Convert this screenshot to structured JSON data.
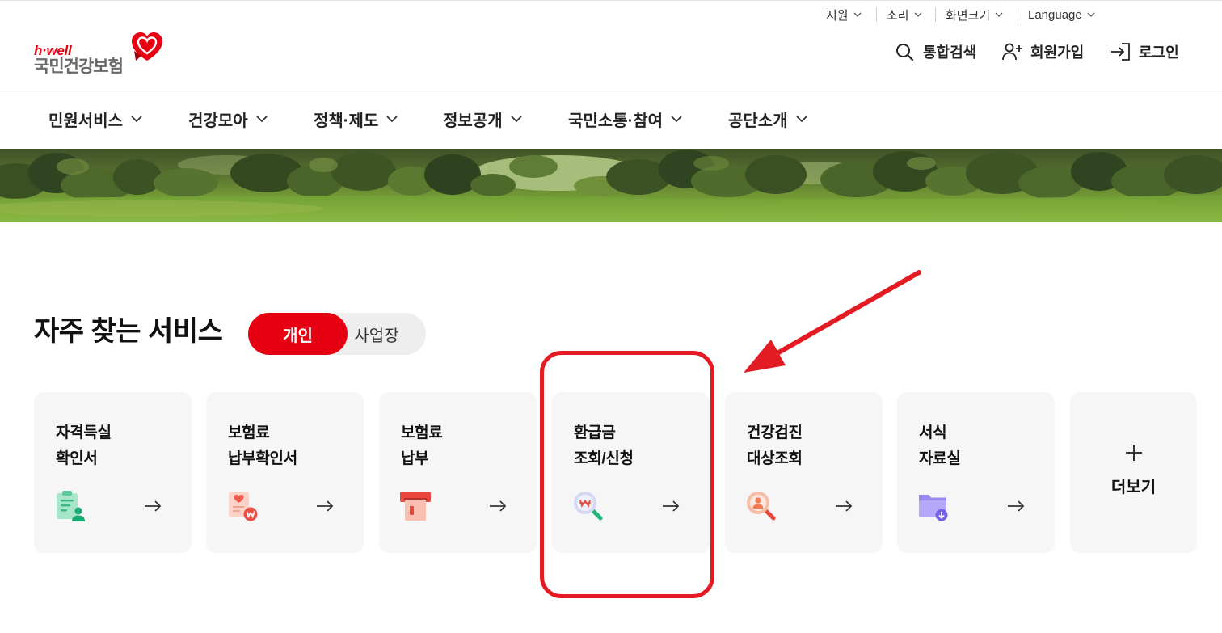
{
  "utility_menu": {
    "items": [
      {
        "label": "지원",
        "icon": "chevron-down-icon"
      },
      {
        "label": "소리",
        "icon": "chevron-down-icon"
      },
      {
        "label": "화면크기",
        "icon": "chevron-down-icon"
      },
      {
        "label": "Language",
        "icon": "chevron-down-icon"
      }
    ]
  },
  "logo": {
    "tagline": "h·well",
    "name": "국민건강보험",
    "icon": "heart-logo-icon"
  },
  "header_actions": {
    "search": {
      "label": "통합검색",
      "icon": "search-icon"
    },
    "signup": {
      "label": "회원가입",
      "icon": "user-plus-icon"
    },
    "login": {
      "label": "로그인",
      "icon": "login-icon"
    }
  },
  "nav": {
    "items": [
      {
        "label": "민원서비스"
      },
      {
        "label": "건강모아"
      },
      {
        "label": "정책·제도"
      },
      {
        "label": "정보공개"
      },
      {
        "label": "국민소통·참여"
      },
      {
        "label": "공단소개"
      }
    ]
  },
  "frequent_services": {
    "title": "자주 찾는 서비스",
    "tabs": [
      {
        "label": "개인",
        "active": true
      },
      {
        "label": "사업장",
        "active": false
      }
    ],
    "cards": [
      {
        "line1": "자격득실",
        "line2": "확인서",
        "icon": "clipboard-person-icon"
      },
      {
        "line1": "보험료",
        "line2": "납부확인서",
        "icon": "receipt-won-icon"
      },
      {
        "line1": "보험료",
        "line2": "납부",
        "icon": "payment-card-icon"
      },
      {
        "line1": "환급금",
        "line2": "조회/신청",
        "icon": "won-magnifier-icon"
      },
      {
        "line1": "건강검진",
        "line2": "대상조회",
        "icon": "person-magnifier-icon"
      },
      {
        "line1": "서식",
        "line2": "자료실",
        "icon": "folder-download-icon"
      }
    ],
    "more": {
      "label": "더보기",
      "icon": "plus-icon"
    }
  },
  "colors": {
    "brand_red": "#e60012",
    "card_bg": "#f6f6f6",
    "annotation_red": "#e31b23",
    "tab_bg": "#eeeeee"
  }
}
